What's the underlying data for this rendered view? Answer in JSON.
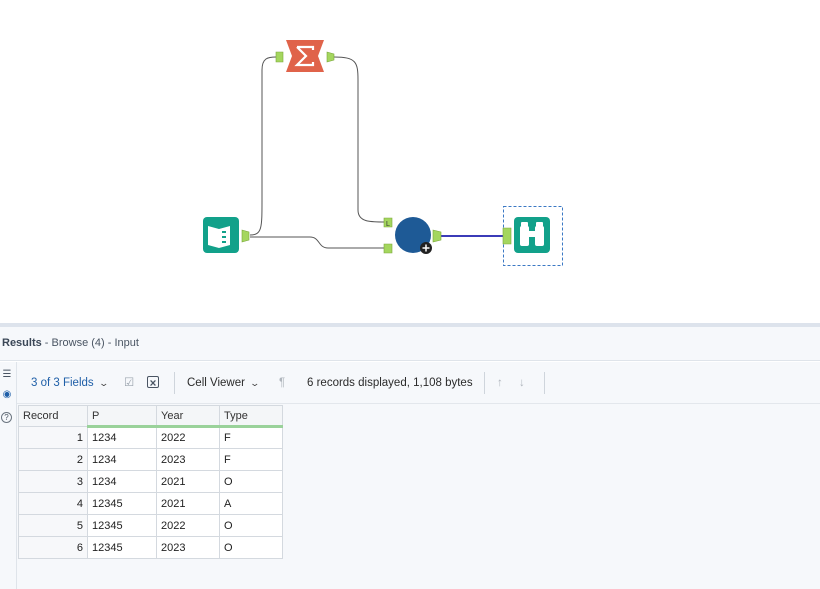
{
  "results": {
    "title_bold": "Results",
    "title_rest": " - Browse (4) - Input"
  },
  "toolbar": {
    "fields_label": "3 of 3 Fields",
    "viewer_label": "Cell Viewer",
    "record_info": "6 records displayed, 1,108 bytes"
  },
  "table": {
    "headers": [
      "Record",
      "P",
      "Year",
      "Type"
    ],
    "rows": [
      [
        "1",
        "1234",
        "2022",
        "F"
      ],
      [
        "2",
        "1234",
        "2023",
        "F"
      ],
      [
        "3",
        "1234",
        "2021",
        "O"
      ],
      [
        "4",
        "12345",
        "2021",
        "A"
      ],
      [
        "5",
        "12345",
        "2022",
        "O"
      ],
      [
        "6",
        "12345",
        "2023",
        "O"
      ]
    ]
  },
  "colors": {
    "summarize_tool": "#e0634a",
    "input_tool": "#12a18a",
    "join_tool": "#1e5a96",
    "browse_tool": "#12a18a",
    "connector_anchor": "#a4d65e",
    "selected_connection": "#3b3bb8",
    "fields_link": "#1f5fa8"
  },
  "icons": {
    "summarize": "sigma-icon",
    "input": "book-icon",
    "join": "circle-icon",
    "browse": "binoculars-icon"
  }
}
